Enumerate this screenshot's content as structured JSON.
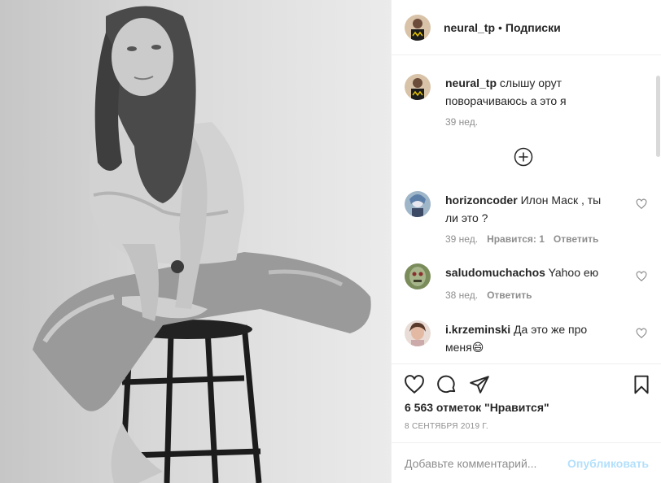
{
  "post": {
    "author": "neural_tp",
    "separator": "•",
    "follow_label": "Подписки"
  },
  "caption": {
    "username": "neural_tp",
    "text": "слышу орут поворачиваюсь а это я",
    "time": "39 нед."
  },
  "load_more_icon": "plus-circle-icon",
  "comments": [
    {
      "username": "horizoncoder",
      "text": "Илон Маск , ты ли это ?",
      "time": "39 нед.",
      "likes": "Нравится: 1",
      "reply": "Ответить"
    },
    {
      "username": "saludomuchachos",
      "text": "Yahoo ею",
      "time": "38 нед.",
      "reply": "Ответить"
    },
    {
      "username": "i.krzeminski",
      "text": "Да это же про меня",
      "emoji": "😄"
    }
  ],
  "actions": {
    "likes_text": "6 563 отметок \"Нравится\"",
    "date": "8 СЕНТЯБРЯ 2019 Г."
  },
  "add_comment": {
    "placeholder": "Добавьте комментарий...",
    "publish_label": "Опубликовать"
  },
  "colors": {
    "text": "#262626",
    "muted": "#8e8e8e",
    "publish_disabled": "#b2dffc",
    "border": "#efefef"
  }
}
